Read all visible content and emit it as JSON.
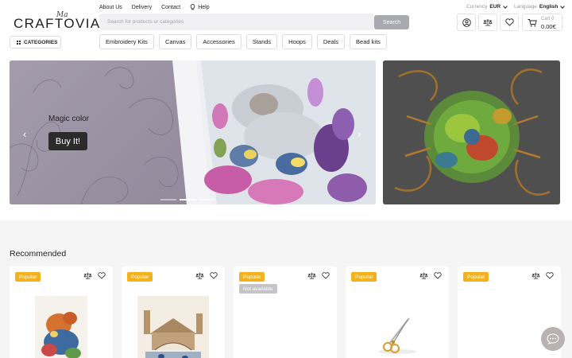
{
  "brand": {
    "name": "CRAFTOVIA",
    "script": "Ma"
  },
  "top_links": [
    {
      "label": "About Us"
    },
    {
      "label": "Delivery"
    },
    {
      "label": "Contact"
    },
    {
      "label": "Help",
      "icon": "lightbulb-icon"
    }
  ],
  "search": {
    "placeholder": "Search for products or categories",
    "button": "Search"
  },
  "currency": {
    "label": "Currency",
    "value": "EUR"
  },
  "language": {
    "label": "Language",
    "value": "English"
  },
  "header_icons": [
    "account-icon",
    "compare-icon",
    "wishlist-icon"
  ],
  "cart": {
    "label": "Cart 0",
    "total": "0.00€",
    "icon": "cart-icon"
  },
  "categories_button": "CATEGORIES",
  "nav": [
    "Embroidery Kits",
    "Canvas",
    "Accessories",
    "Stands",
    "Hoops",
    "Deals",
    "Bead kits"
  ],
  "hero": {
    "title": "Magic color",
    "cta": "Buy It!",
    "slides": 3,
    "active_slide": 2
  },
  "recommended": {
    "title": "Recommended",
    "products": [
      {
        "badge": "Popular",
        "status": "",
        "image": "fox-embroidery"
      },
      {
        "badge": "Popular",
        "status": "",
        "image": "bridge-embroidery"
      },
      {
        "badge": "Popular",
        "status": "Not available",
        "image": ""
      },
      {
        "badge": "Popular",
        "status": "",
        "image": "gold-scissors"
      },
      {
        "badge": "Popular",
        "status": "",
        "image": ""
      }
    ]
  },
  "colors": {
    "accent_badge": "#f2b11d",
    "search_button": "#a9a9b0",
    "cta": "#2b2b2b"
  }
}
